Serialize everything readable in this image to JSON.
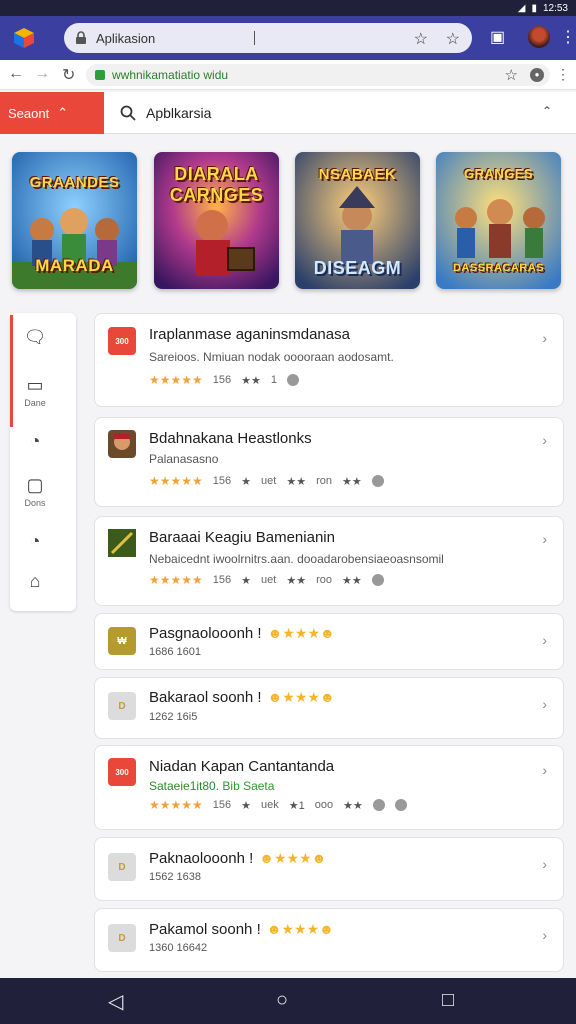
{
  "status": {
    "clock": "12:53"
  },
  "browser": {
    "tab_title": "Aplikasion",
    "url": "wwhnikamatiatio widu"
  },
  "search": {
    "category_label": "Seaont",
    "query": "Apblkarsia"
  },
  "featured_games": [
    {
      "title_top": "GRAANDES",
      "title_bottom": "MARADA",
      "bg": "#2f7cc4"
    },
    {
      "title_top": "DIARALA CARNGES",
      "title_bottom": "",
      "bg": "#7a2aa8"
    },
    {
      "title_top": "NSABAEK",
      "title_bottom": "DISEAGM",
      "bg": "#37598a"
    },
    {
      "title_top": "GRANGES",
      "title_bottom": "DASSRACARAS",
      "bg": "#4e8fd4"
    }
  ],
  "side_rail": [
    {
      "icon": "chat-icon",
      "label": ""
    },
    {
      "icon": "grid-icon",
      "label": "Dane"
    },
    {
      "icon": "clock-icon",
      "label": ""
    },
    {
      "icon": "chat-icon",
      "label": "Dons"
    },
    {
      "icon": "clock-icon",
      "label": ""
    },
    {
      "icon": "tag-icon",
      "label": ""
    }
  ],
  "apps": [
    {
      "icon_text": "300",
      "icon_color": "#e8473a",
      "title": "Iraplanmase aganinsmdanasa",
      "desc": "Sareioos. Nmiuan nodak ooooraan aodosamt.",
      "rating": "156",
      "meta2": "1",
      "meta3": "",
      "stars": "★★★★★"
    },
    {
      "icon_text": "",
      "icon_color": "#6a4a2a",
      "title": "Bdahnakana Heastlonks",
      "desc": "Palanasasno",
      "rating": "156",
      "meta2": "uet",
      "meta3": "ron",
      "stars": "★★★★★"
    },
    {
      "icon_text": "",
      "icon_color": "#5b7a2a",
      "title": "Baraaai Keagiu Bamenianin",
      "desc": "Nebaicednt iwoolrnitrs.aan. dooadarobensiaeoasnsomil",
      "rating": "156",
      "meta2": "uet",
      "meta3": "roo",
      "stars": "★★★★★"
    },
    {
      "icon_text": "₩",
      "icon_color": "#b59a2e",
      "title": "Pasgnaolooonh !",
      "sub": "1686 1601"
    },
    {
      "icon_text": "D",
      "icon_color": "#d8d8d8",
      "title": "Bakaraol soonh !",
      "sub": "1262 16i5"
    },
    {
      "icon_text": "300",
      "icon_color": "#e8473a",
      "title": "Niadan Kapan Cantantanda",
      "desc": "Sataeie1it80.",
      "desc_highlight": "Bib Saeta",
      "rating": "156",
      "meta2": "uek",
      "meta3": "ooo",
      "stars": "★★★★★"
    },
    {
      "icon_text": "D",
      "icon_color": "#d8d8d8",
      "title": "Paknaolooonh !",
      "sub": "1562 1638"
    },
    {
      "icon_text": "D",
      "icon_color": "#d8d8d8",
      "title": "Pakamol soonh !",
      "sub": "1360 16642"
    }
  ]
}
